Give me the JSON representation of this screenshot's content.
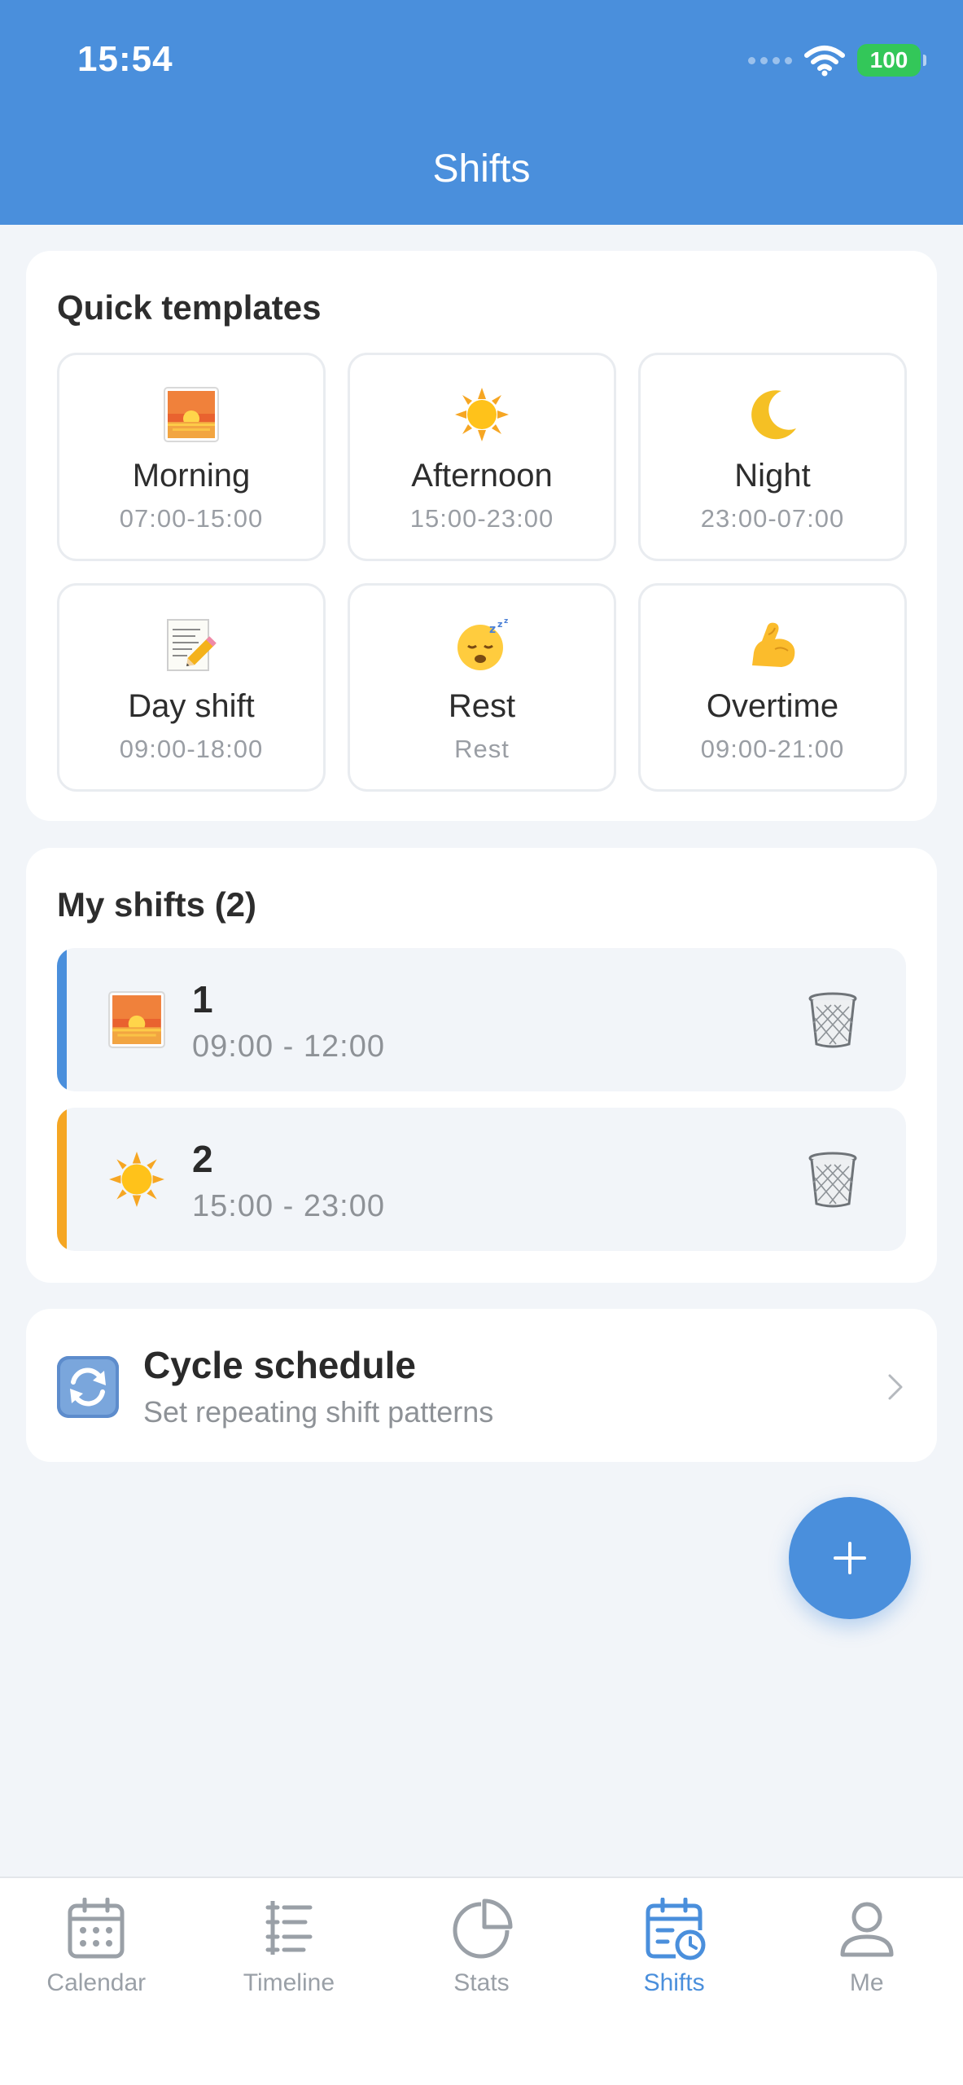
{
  "status_bar": {
    "time": "15:54",
    "battery": "100"
  },
  "header": {
    "title": "Shifts"
  },
  "quick_templates": {
    "title": "Quick templates",
    "items": [
      {
        "name": "Morning",
        "time": "07:00-15:00",
        "icon": "sunrise-icon"
      },
      {
        "name": "Afternoon",
        "time": "15:00-23:00",
        "icon": "sun-icon"
      },
      {
        "name": "Night",
        "time": "23:00-07:00",
        "icon": "crescent-moon-icon"
      },
      {
        "name": "Day shift",
        "time": "09:00-18:00",
        "icon": "memo-icon"
      },
      {
        "name": "Rest",
        "time": "Rest",
        "icon": "sleeping-face-icon"
      },
      {
        "name": "Overtime",
        "time": "09:00-21:00",
        "icon": "flexed-biceps-icon"
      }
    ]
  },
  "my_shifts": {
    "title": "My shifts (2)",
    "items": [
      {
        "name": "1",
        "time": "09:00 - 12:00",
        "icon": "sunrise-icon",
        "color": "#4a8fdc"
      },
      {
        "name": "2",
        "time": "15:00 - 23:00",
        "icon": "sun-icon",
        "color": "#f5a623"
      }
    ]
  },
  "cycle": {
    "title": "Cycle schedule",
    "subtitle": "Set repeating shift patterns",
    "icon": "repeat-icon"
  },
  "fab": {
    "label": "+"
  },
  "tabs": [
    {
      "label": "Calendar",
      "icon": "calendar-icon",
      "active": false
    },
    {
      "label": "Timeline",
      "icon": "timeline-icon",
      "active": false
    },
    {
      "label": "Stats",
      "icon": "pie-chart-icon",
      "active": false
    },
    {
      "label": "Shifts",
      "icon": "calendar-clock-icon",
      "active": true
    },
    {
      "label": "Me",
      "icon": "user-icon",
      "active": false
    }
  ],
  "colors": {
    "accent": "#4a8fdc",
    "background": "#f2f5f9",
    "inactive": "#9aa0a7"
  }
}
